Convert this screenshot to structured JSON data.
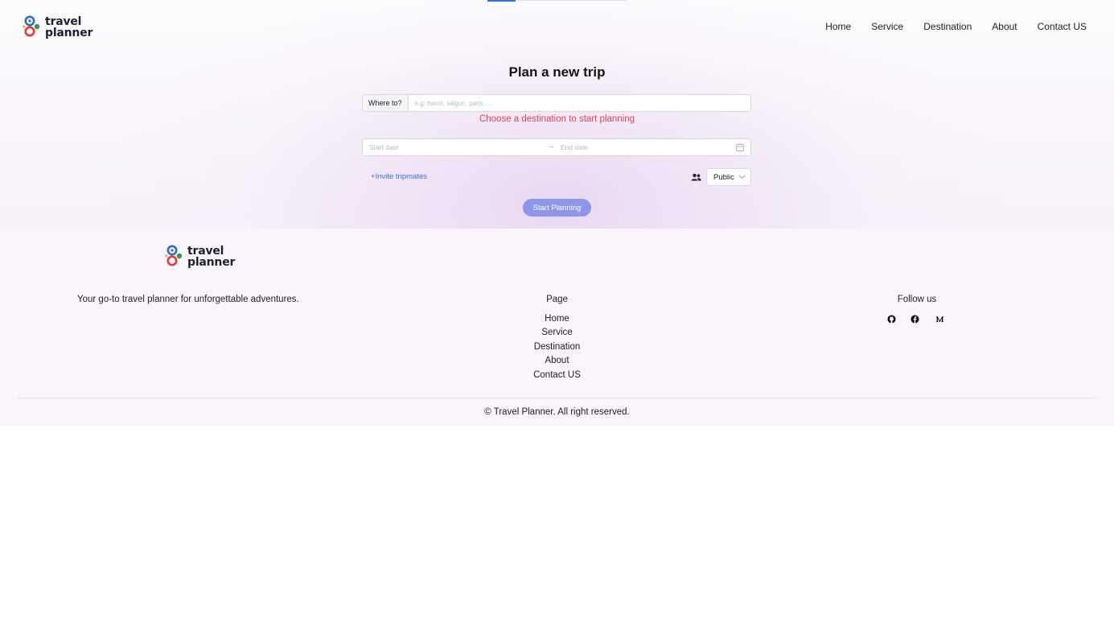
{
  "header": {
    "logo": {
      "line1": "travel",
      "line2": "planner"
    },
    "nav": [
      "Home",
      "Service",
      "Destination",
      "About",
      "Contact US"
    ]
  },
  "planner": {
    "title": "Plan a new trip",
    "where_label": "Where to?",
    "where_placeholder": "e.g: hanoi, saigon, paris, ...",
    "where_value": "",
    "error_message": "Choose a destination to start planning",
    "start_date_placeholder": "Start date",
    "end_date_placeholder": "End date",
    "invite_label": "Invite tripmates",
    "visibility_value": "Public",
    "start_button": "Start Planning"
  },
  "footer": {
    "logo": {
      "line1": "travel",
      "line2": "planner"
    },
    "tagline": "Your go-to travel planner for unforgettable adventures.",
    "page_heading": "Page",
    "page_links": [
      "Home",
      "Service",
      "Destination",
      "About",
      "Contact US"
    ],
    "follow_heading": "Follow us",
    "social": [
      "github-icon",
      "facebook-icon",
      "medium-icon"
    ],
    "copyright": "© Travel Planner. All right reserved."
  },
  "colors": {
    "accent_blue": "#3d6fe0",
    "button": "#8e96e8",
    "error": "#e0464f",
    "logo_blue": "#2d6fd1",
    "logo_red": "#e53935",
    "logo_green": "#2e9b47",
    "logo_orange": "#f5a623"
  }
}
